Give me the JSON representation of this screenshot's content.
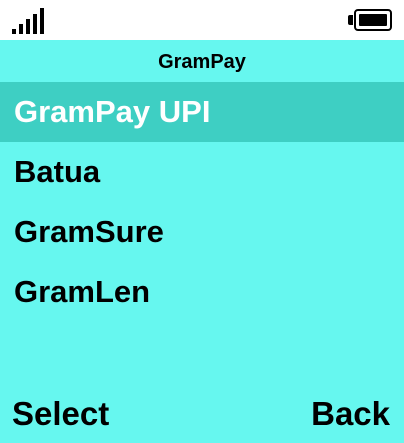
{
  "status_bar": {
    "signal_icon": "signal-strength-icon",
    "battery_icon": "battery-full-icon"
  },
  "header": {
    "title": "GramPay"
  },
  "menu": {
    "selected_index": 0,
    "items": [
      {
        "label": "GramPay UPI"
      },
      {
        "label": "Batua"
      },
      {
        "label": "GramSure"
      },
      {
        "label": "GramLen"
      }
    ]
  },
  "softkeys": {
    "left": "Select",
    "right": "Back"
  },
  "colors": {
    "background": "#66f7ef",
    "selected_row": "#3ecfc3",
    "selected_text": "#ffffff",
    "status_bar": "#ffffff"
  }
}
